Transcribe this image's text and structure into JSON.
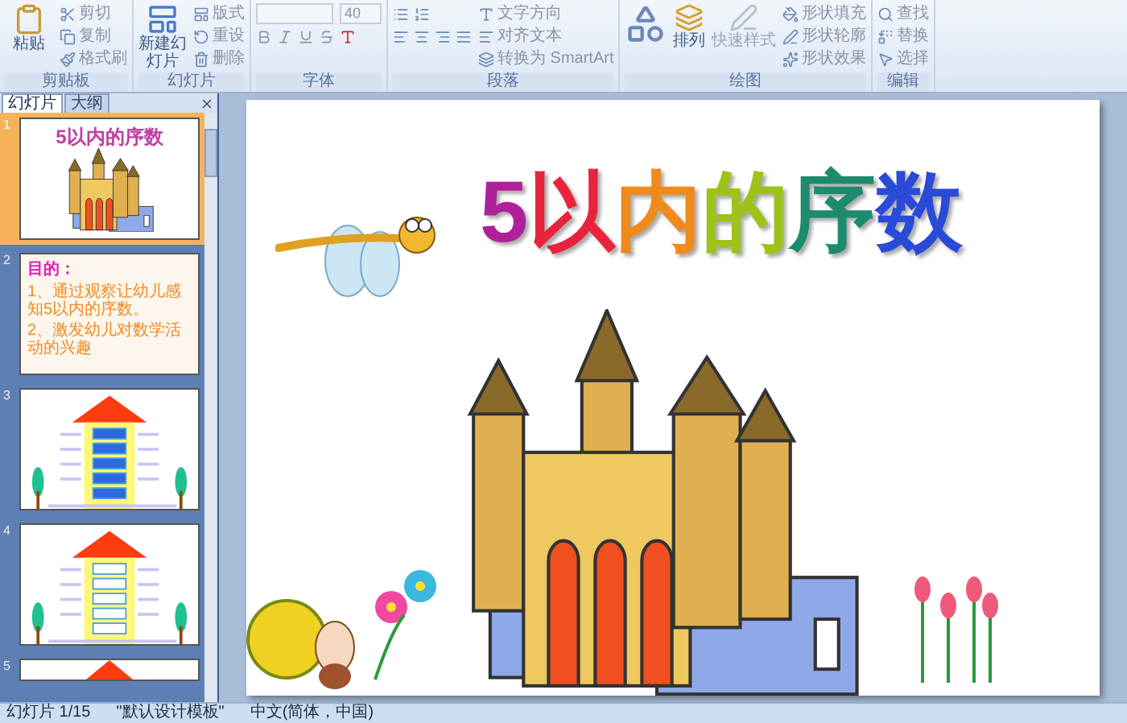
{
  "ribbon": {
    "groups": [
      {
        "label": "剪贴板",
        "big": "粘贴",
        "small": [
          "剪切",
          "复制",
          "格式刷"
        ]
      },
      {
        "label": "幻灯片",
        "big": "新建幻灯片",
        "small": [
          "版式",
          "重设",
          "删除"
        ]
      },
      {
        "label": "字体",
        "font_size": "40"
      },
      {
        "label": "段落",
        "small": [
          "文字方向",
          "对齐文本",
          "转换为 SmartArt"
        ]
      },
      {
        "label": "绘图",
        "big": "排列",
        "quick": "快速样式",
        "small": [
          "形状填充",
          "形状轮廓",
          "形状效果"
        ]
      },
      {
        "label": "编辑",
        "small": [
          "查找",
          "替换",
          "选择"
        ]
      }
    ]
  },
  "panel": {
    "tabs": [
      {
        "label": "幻灯片",
        "selected": true
      },
      {
        "label": "大纲",
        "selected": false
      }
    ],
    "slides": [
      {
        "number": "1",
        "kind": "title",
        "selected": true,
        "title": "5以内的序数"
      },
      {
        "number": "2",
        "kind": "text",
        "selected": false,
        "heading": "目的：",
        "lines": [
          "1、通过观察让幼儿感知5以内的序数。",
          "2、激发幼儿对数学活动的兴趣"
        ]
      },
      {
        "number": "3",
        "kind": "house",
        "selected": false
      },
      {
        "number": "4",
        "kind": "house-empty",
        "selected": false
      },
      {
        "number": "5",
        "kind": "partial",
        "selected": false
      }
    ]
  },
  "slide": {
    "title": "5以内的序数"
  },
  "status_bar": {
    "slide": "幻灯片 1/15",
    "theme": "\"默认设计模板\"",
    "language": "中文(简体，中国)"
  }
}
